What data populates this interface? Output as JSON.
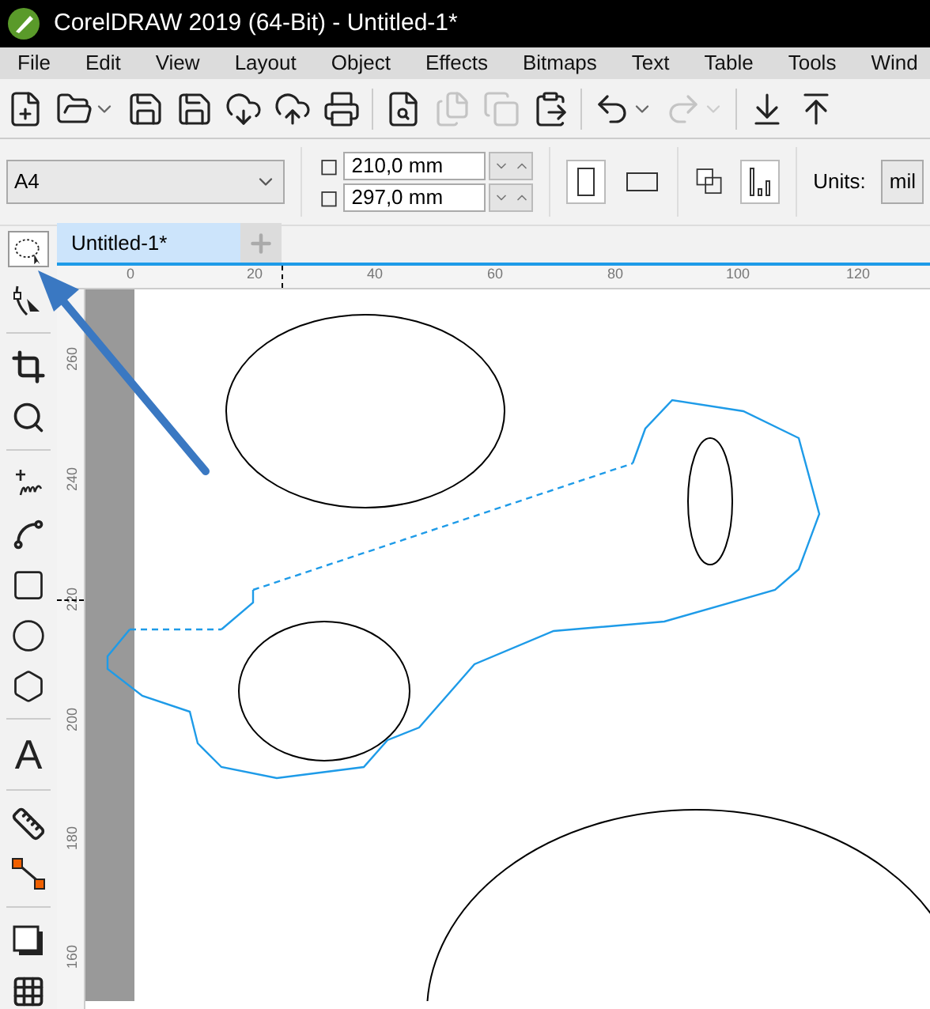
{
  "window": {
    "title": "CorelDRAW 2019 (64-Bit) - Untitled-1*"
  },
  "menu": [
    "File",
    "Edit",
    "View",
    "Layout",
    "Object",
    "Effects",
    "Bitmaps",
    "Text",
    "Table",
    "Tools",
    "Wind"
  ],
  "toolbar": [
    {
      "kind": "new",
      "disabled": false
    },
    {
      "kind": "open",
      "disabled": false
    },
    {
      "kind": "save",
      "disabled": false
    },
    {
      "kind": "save-new",
      "disabled": false
    },
    {
      "kind": "cloud-down",
      "disabled": false
    },
    {
      "kind": "cloud-up",
      "disabled": false
    },
    {
      "kind": "print",
      "disabled": false
    },
    {
      "kind": "preview",
      "disabled": false
    },
    {
      "kind": "cut",
      "disabled": true
    },
    {
      "kind": "copy",
      "disabled": true
    },
    {
      "kind": "paste",
      "disabled": false
    },
    {
      "kind": "undo",
      "disabled": false
    },
    {
      "kind": "redo",
      "disabled": true
    },
    {
      "kind": "import",
      "disabled": false
    },
    {
      "kind": "export",
      "disabled": false
    }
  ],
  "property_bar": {
    "paper_size": "A4",
    "width": "210,0 mm",
    "height": "297,0 mm",
    "units_label": "Units:",
    "units_value": "mil"
  },
  "tabs": [
    {
      "label": "Untitled-1*",
      "selected": true
    }
  ],
  "tools": [
    {
      "kind": "lasso",
      "selected": true
    },
    {
      "kind": "shape",
      "selected": false
    },
    {
      "kind": "crop",
      "selected": false
    },
    {
      "kind": "zoom",
      "selected": false
    },
    {
      "kind": "freehand",
      "selected": false
    },
    {
      "kind": "artistic",
      "selected": false
    },
    {
      "kind": "rectangle",
      "selected": false
    },
    {
      "kind": "ellipse",
      "selected": false
    },
    {
      "kind": "polygon",
      "selected": false
    },
    {
      "kind": "text",
      "glyph": "A",
      "selected": false
    },
    {
      "kind": "dimension",
      "selected": false
    },
    {
      "kind": "connector",
      "selected": false
    },
    {
      "kind": "shadow",
      "selected": false
    },
    {
      "kind": "transparency",
      "selected": false
    }
  ],
  "h_ruler": [
    "0",
    "20",
    "40",
    "60",
    "80",
    "100",
    "120"
  ],
  "v_ruler": [
    "260",
    "240",
    "220",
    "200",
    "180",
    "160"
  ]
}
